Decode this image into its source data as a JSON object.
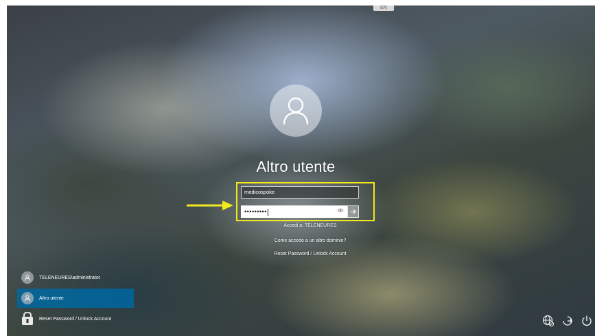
{
  "window": {
    "top_indicator": "EN"
  },
  "login": {
    "title": "Altro utente",
    "username_value": "medicospoke",
    "password_masked": "•••••••••",
    "sign_in_to": "Accedi a: TELENEURES",
    "other_domain_link": "Come accedo a un altro dominio?",
    "reset_link": "Reset Password / Unlock Account"
  },
  "user_list": {
    "items": [
      {
        "label": "TELENEURES\\administrator",
        "selected": false
      },
      {
        "label": "Altro utente",
        "selected": true
      },
      {
        "label": "Reset Password / Unlock Account",
        "selected": false
      }
    ]
  },
  "colors": {
    "highlight": "#f2ea1d",
    "selected_user": "#0067a0"
  },
  "icons": {
    "avatar": "user-icon",
    "submit": "arrow-right-icon",
    "reveal": "eye-icon",
    "network": "network-icon",
    "accessibility": "ease-of-access-icon",
    "power": "power-icon"
  }
}
